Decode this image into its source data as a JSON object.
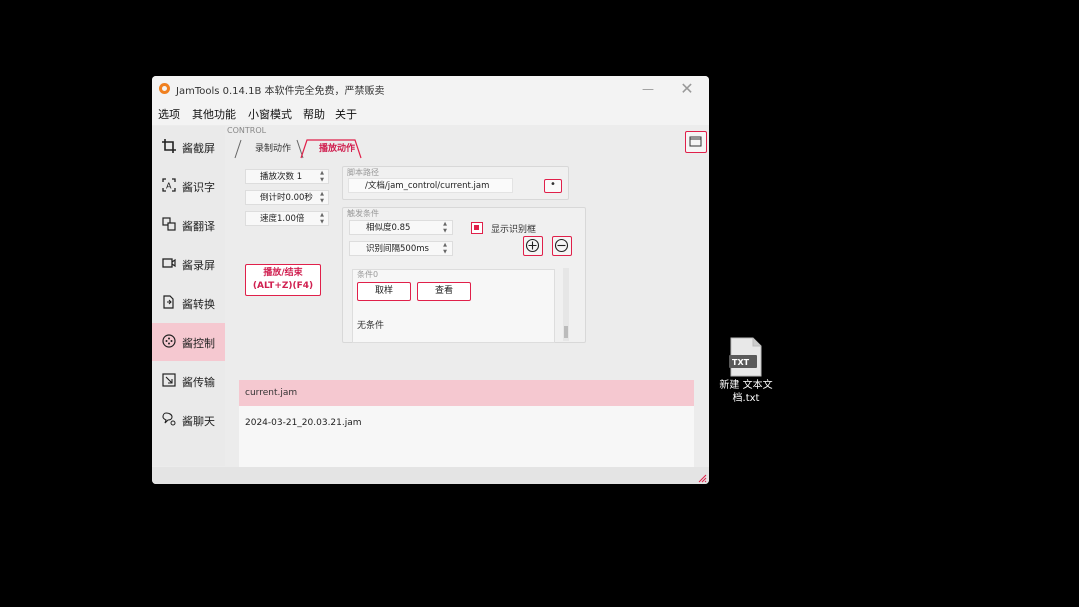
{
  "window": {
    "title": "JamTools 0.14.1B 本软件完全免费，严禁贩卖",
    "minimize_glyph": "—",
    "maximize_glyph": "▢",
    "close_glyph": "✕"
  },
  "menu": [
    "选项",
    "其他功能",
    "小窗模式",
    "帮助",
    "关于"
  ],
  "sidebar": {
    "items": [
      {
        "label": "酱截屏",
        "icon": "crop-icon"
      },
      {
        "label": "酱识字",
        "icon": "text-recognize-icon"
      },
      {
        "label": "酱翻译",
        "icon": "translate-icon"
      },
      {
        "label": "酱录屏",
        "icon": "screen-record-icon"
      },
      {
        "label": "酱转换",
        "icon": "convert-icon"
      },
      {
        "label": "酱控制",
        "icon": "control-icon",
        "active": true
      },
      {
        "label": "酱传输",
        "icon": "transfer-icon"
      },
      {
        "label": "酱聊天",
        "icon": "chat-icon"
      }
    ]
  },
  "control": {
    "section_label": "CONTROL",
    "tabs": [
      "录制动作",
      "播放动作"
    ],
    "active_tab": "播放动作",
    "spinners": [
      "播放次数 1",
      "倒计时0.00秒",
      "速度1.00倍"
    ],
    "play_button_line1": "播放/结束",
    "play_button_line2": "(ALT+Z)(F4)",
    "script_path": {
      "title": "脚本路径",
      "value": "/文档/jam_control/current.jam",
      "browse_label": "•"
    },
    "trigger": {
      "title": "触发条件",
      "similarity": "相似度0.85",
      "interval": "识别间隔500ms",
      "show_label": "显示识别框",
      "show_checked": true,
      "condition_title": "条件0",
      "sample_button": "取样",
      "view_button": "查看",
      "condition_text": "无条件"
    },
    "files": [
      {
        "name": "current.jam",
        "selected": true
      },
      {
        "name": "2024-03-21_20.03.21.jam",
        "selected": false
      }
    ]
  },
  "desktop_file": {
    "badge": "TXT",
    "name_line1": "新建 文本文",
    "name_line2": "档.txt"
  },
  "colors": {
    "accent": "#e0204a",
    "selected_bg": "#f5c8d0"
  }
}
